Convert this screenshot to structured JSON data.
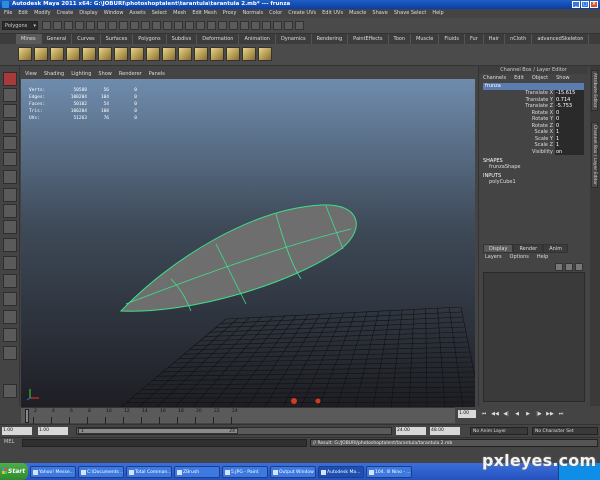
{
  "window": {
    "title": "Autodesk Maya 2011 x64: G:\\JOBURI\\photoshoptalent\\tarantula\\tarantula 2.mb*  ---  frunza",
    "icon": "maya-app-icon",
    "controls": [
      "_",
      "□",
      "×"
    ]
  },
  "menubar": [
    "File",
    "Edit",
    "Modify",
    "Create",
    "Display",
    "Window",
    "Assets",
    "Select",
    "Mesh",
    "Edit Mesh",
    "Proxy",
    "Normals",
    "Color",
    "Create UVs",
    "Edit UVs",
    "Muscle",
    "Shave",
    "Shave Select",
    "Help"
  ],
  "status_line": {
    "mode": "Polygons"
  },
  "shelf_tabs": [
    "Mines",
    "General",
    "Curves",
    "Surfaces",
    "Polygons",
    "Subdivs",
    "Deformation",
    "Animation",
    "Dynamics",
    "Rendering",
    "PaintEffects",
    "Toon",
    "Muscle",
    "Fluids",
    "Fur",
    "Hair",
    "nCloth",
    "advancedSkeleton"
  ],
  "active_shelf_tab": "Mines",
  "panel_menu": [
    "View",
    "Shading",
    "Lighting",
    "Show",
    "Renderer",
    "Panels"
  ],
  "hud": {
    "rows": [
      {
        "label": "Verts:",
        "a": "50588",
        "b": "56",
        "c": "0"
      },
      {
        "label": "Edges:",
        "a": "100204",
        "b": "104",
        "c": "0"
      },
      {
        "label": "Faces:",
        "a": "50102",
        "b": "54",
        "c": "0"
      },
      {
        "label": "Tris:",
        "a": "100204",
        "b": "108",
        "c": "0"
      },
      {
        "label": "UVs:",
        "a": "51263",
        "b": "76",
        "c": "0"
      }
    ]
  },
  "channel_box": {
    "title": "Channel Box / Layer Editor",
    "menu": [
      "Channels",
      "Edit",
      "Object",
      "Show"
    ],
    "object": "frunza",
    "attributes": [
      {
        "name": "Translate X",
        "value": "-15.615"
      },
      {
        "name": "Translate Y",
        "value": "0.714"
      },
      {
        "name": "Translate Z",
        "value": "-5.753"
      },
      {
        "name": "Rotate X",
        "value": "0"
      },
      {
        "name": "Rotate Y",
        "value": "0"
      },
      {
        "name": "Rotate Z",
        "value": "0"
      },
      {
        "name": "Scale X",
        "value": "1"
      },
      {
        "name": "Scale Y",
        "value": "1"
      },
      {
        "name": "Scale Z",
        "value": "1"
      },
      {
        "name": "Visibility",
        "value": "on"
      }
    ],
    "shapes_label": "SHAPES",
    "shape_name": "frunzaShape",
    "inputs_label": "INPUTS",
    "input_name": "polyCube1"
  },
  "layer_editor": {
    "tabs": [
      "Display",
      "Render",
      "Anim"
    ],
    "active_tab": "Display",
    "menu": [
      "Layers",
      "Options",
      "Help"
    ]
  },
  "side_tabs": [
    "Attribute Editor",
    "Channel Box / Layer Editor"
  ],
  "time_slider": {
    "ticks": [
      "2",
      "4",
      "6",
      "8",
      "10",
      "12",
      "14",
      "16",
      "18",
      "20",
      "22",
      "24"
    ],
    "current_frame": "1.00",
    "playback_buttons": [
      "⏮",
      "◀◀",
      "◀|",
      "◀",
      "▶",
      "|▶",
      "▶▶",
      "⏭"
    ]
  },
  "range_slider": {
    "start": "1.00",
    "playback_start": "1.00",
    "handle_left": "1",
    "handle_right": "24",
    "playback_end": "24.00",
    "end": "48.00",
    "anim_layer": "No Anim Layer",
    "character_set": "No Character Set"
  },
  "command_line": {
    "label": "MEL",
    "result": "// Result: G:/JOBURI/photoshoptalent/tarantula/tarantula 2.mb"
  },
  "taskbar": {
    "start": "Start",
    "items": [
      "Yahoo! Messe...",
      "C:\\Documents ...",
      "Total Comman...",
      "ZBrush",
      "5.JPG - Paint",
      "Output Window",
      "Autodesk Ma...",
      "104. Ill Nino - ..."
    ],
    "active": "Autodesk Ma..."
  },
  "watermark": "pxleyes.com",
  "colors": {
    "wireframe": "#3fe08a",
    "mesh_fill": "#6e6e6e",
    "grid": "#111111"
  }
}
